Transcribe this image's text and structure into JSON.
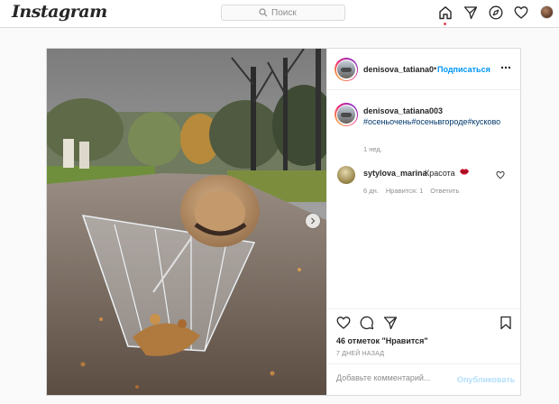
{
  "header": {
    "logo": "Instagram",
    "search_placeholder": "Поиск",
    "nav_icons": [
      "home-icon",
      "direct-icon",
      "explore-icon",
      "activity-icon",
      "profile-avatar"
    ]
  },
  "post": {
    "author": "denisova_tatiana003",
    "author_header_display": "denisova_tatiana00",
    "follow_label": "Подписаться",
    "caption_user": "denisova_tatiana003",
    "caption_tags": "#осеньочень#осеньвгороде#кусково",
    "caption_time": "1 нед.",
    "comment": {
      "user": "sytylova_marina",
      "text": "Красота",
      "emoji": "lips-icon",
      "time": "6 дн.",
      "likes": "Нравится: 1",
      "reply": "Ответить"
    },
    "likes_text": "46 отметок \"Нравится\"",
    "date": "7 ДНЕЙ НАЗАД",
    "comment_placeholder": "Добавьте комментарий...",
    "publish_label": "Опубликовать"
  },
  "colors": {
    "link": "#0095f6",
    "publish_disabled": "#b2dffc",
    "hashtag": "#00376b",
    "notification_dot": "#ed4956"
  }
}
